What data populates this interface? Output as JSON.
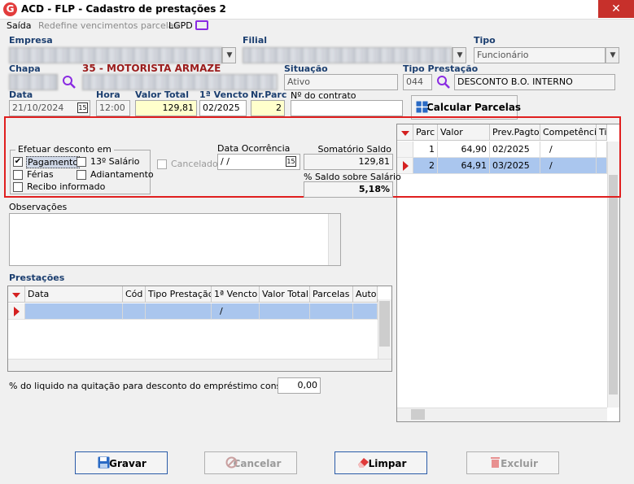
{
  "window": {
    "title": "ACD - FLP - Cadastro de prestações 2",
    "close": "✕",
    "app_letter": "G"
  },
  "menu": {
    "saida": "Saída",
    "redefine": "Redefine vencimentos parcelas",
    "lgpd": "LGPD"
  },
  "labels": {
    "empresa": "Empresa",
    "filial": "Filial",
    "tipo": "Tipo",
    "chapa": "Chapa",
    "motorista": "35 - MOTORISTA ARMAZE",
    "situacao": "Situação",
    "tipo_prestacao": "Tipo Prestação",
    "data": "Data",
    "hora": "Hora",
    "valor_total": "Valor Total",
    "primeiro_vencto": "1ª Vencto",
    "nr_parc": "Nr.Parc",
    "nro_contrato": "Nº do contrato",
    "efetuar_desconto": "Efetuar desconto em",
    "data_ocorrencia": "Data Ocorrência",
    "somatorio_saldo": "Somatório Saldo",
    "pct_saldo": "% Saldo sobre Salário",
    "observacoes": "Observações",
    "prestacoes": "Prestações",
    "pct_liquido": "% do liquido na quitação para desconto do empréstimo consignado"
  },
  "fields": {
    "tipo": "Funcionário",
    "situacao": "Ativo",
    "tipo_prest_cod": "044",
    "tipo_prest_desc": "DESCONTO B.O. INTERNO",
    "data": "21/10/2024",
    "hora": "12:00",
    "valor_total": "129,81",
    "primeiro_vencto": "02/2025",
    "nr_parc": "2",
    "nro_contrato": "",
    "data_ocorrencia": " / /",
    "somatorio_saldo": "129,81",
    "pct_saldo": "5,18%",
    "observacoes": "",
    "pct_liquido": "0,00",
    "calendar_glyph": "15"
  },
  "checkboxes": {
    "pagamento": {
      "label": "Pagamento",
      "checked": "✔"
    },
    "decimo_terceiro": {
      "label": "13º Salário"
    },
    "ferias": {
      "label": "Férias"
    },
    "adiantamento": {
      "label": "Adiantamento"
    },
    "recibo": {
      "label": "Recibo informado"
    },
    "cancelado": {
      "label": "Cancelado"
    }
  },
  "buttons": {
    "calcular": "Calcular Parcelas",
    "gravar": "Gravar",
    "cancelar": "Cancelar",
    "limpar": "Limpar",
    "excluir": "Excluir"
  },
  "parcelas_grid": {
    "columns": [
      "Parc",
      "Valor",
      "Prev.Pagto",
      "Competência",
      "Ti"
    ],
    "rows": [
      {
        "parc": "1",
        "valor": "64,90",
        "prev": "02/2025",
        "comp": "/"
      },
      {
        "parc": "2",
        "valor": "64,91",
        "prev": "03/2025",
        "comp": "/"
      }
    ]
  },
  "prestacoes_grid": {
    "columns": [
      "Data",
      "Cód",
      "Tipo Prestação",
      "1ª Vencto",
      "Valor Total",
      "Parcelas",
      "Auto"
    ],
    "rows": [
      {
        "vencto": "/"
      }
    ]
  },
  "colors": {
    "accent_red": "#e01f1f",
    "label_blue": "#1b3e6f",
    "motorista_red": "#9b1c1c",
    "selected_row": "#aac6ee",
    "yellow_field": "#ffffcc"
  }
}
